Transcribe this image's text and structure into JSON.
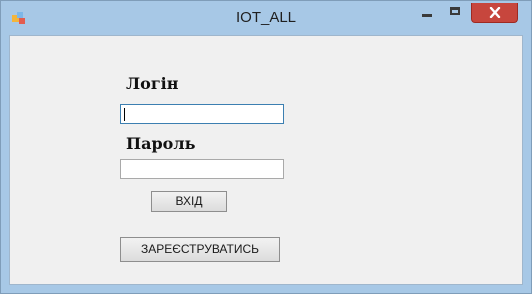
{
  "window": {
    "title": "IOT_ALL",
    "icon": "app-icon",
    "controls": {
      "minimize": "minimize-icon",
      "maximize": "maximize-icon",
      "close": "close-icon"
    }
  },
  "form": {
    "login_label": "Логін",
    "login_value": "",
    "password_label": "Пароль",
    "password_value": "",
    "login_button": "ВХІД",
    "register_button": "ЗАРЕЄСТРУВАТИСЬ"
  },
  "colors": {
    "frame": "#a7c8e6",
    "client": "#f0f0f0",
    "close_button": "#c7463d",
    "focus_border": "#3c7fb1"
  }
}
